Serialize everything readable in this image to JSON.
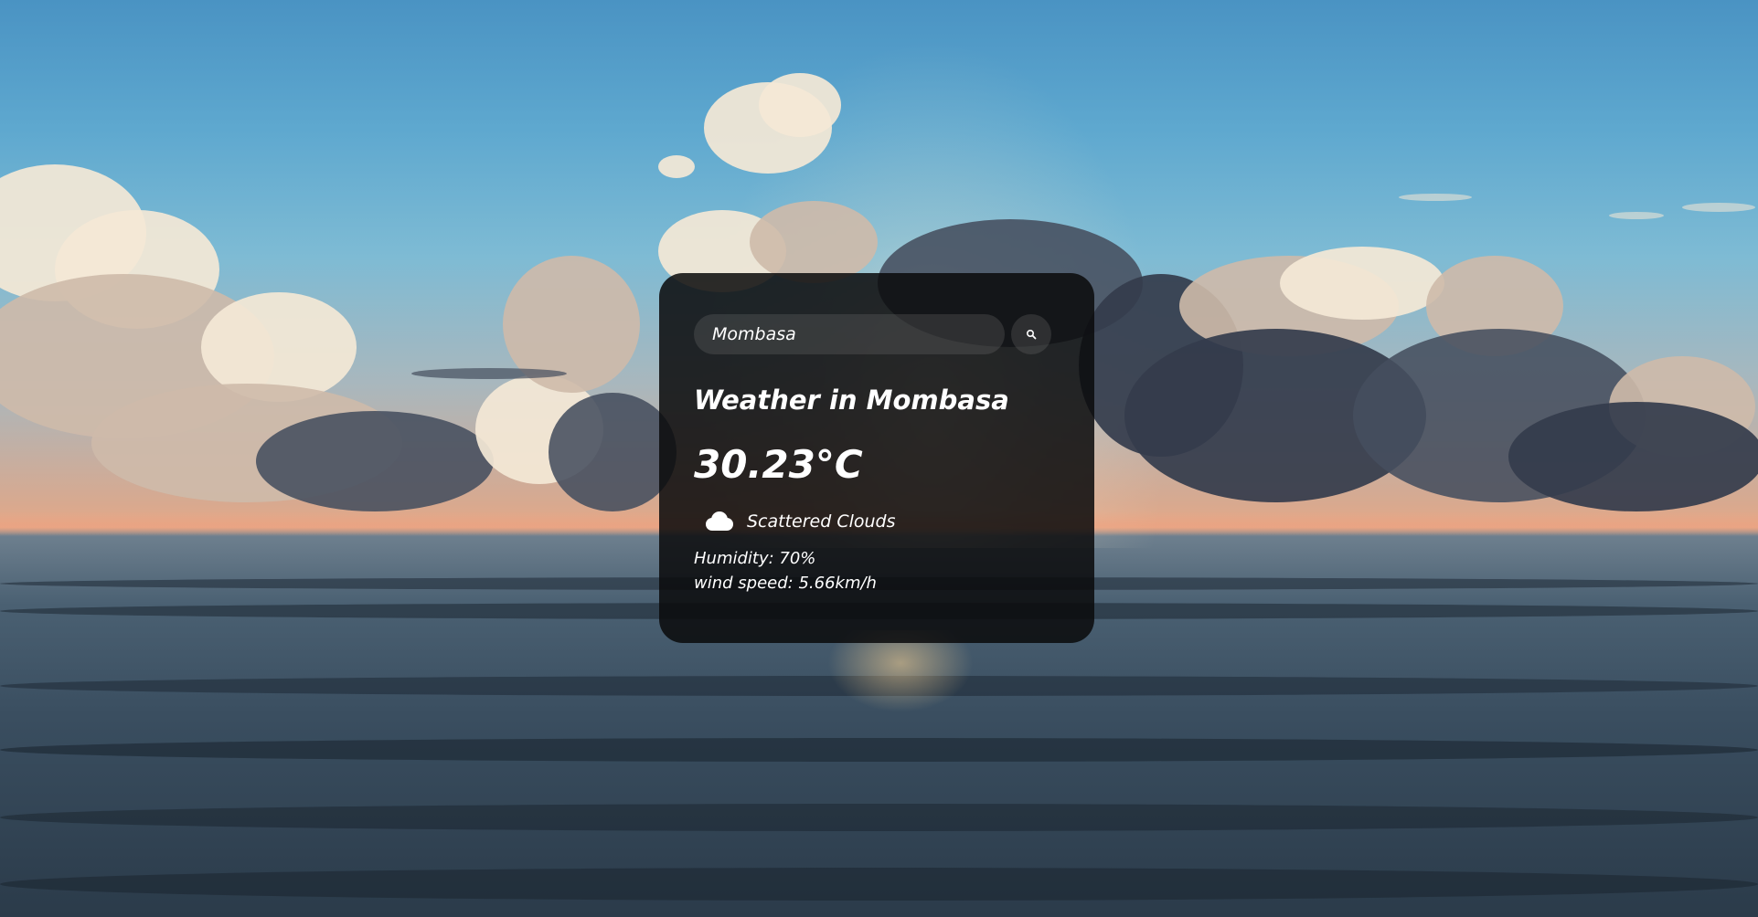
{
  "search": {
    "value": "Mombasa",
    "button_icon": "search-icon"
  },
  "weather": {
    "title": "Weather in Mombasa",
    "temperature": "30.23°C",
    "icon": "cloud-icon",
    "description": "Scattered Clouds",
    "humidity": "Humidity: 70%",
    "wind": "wind speed: 5.66km/h"
  },
  "colors": {
    "card_background": "#0a0a0c",
    "text": "#ffffff",
    "input_background": "#7c7c7c"
  },
  "background": {
    "image": "ocean-sunset-clouds-photo"
  }
}
